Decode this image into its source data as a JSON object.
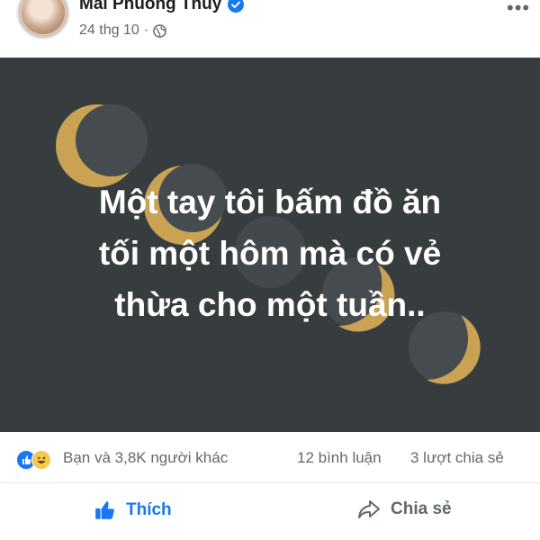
{
  "post": {
    "author": "Mai Phuong Thuy",
    "date": "24 thg 10",
    "separator": "·",
    "text_lines": [
      "Một tay tôi bấm đồ ăn",
      "tối một hôm mà có vẻ",
      "thừa cho một tuần.."
    ],
    "background_color": "#373d3f",
    "moon_color": "#c9a254"
  },
  "stats": {
    "reaction_summary": "Bạn và 3,8K người khác",
    "comments": "12 bình luận",
    "shares": "3 lượt chia sẻ"
  },
  "actions": {
    "like_label": "Thích",
    "share_label": "Chia sẻ"
  },
  "icons": {
    "verified": "verified-badge-icon",
    "globe": "globe-icon",
    "like": "thumbs-up-icon",
    "share": "share-arrow-icon"
  },
  "colors": {
    "accent": "#1877f2",
    "muted_text": "#65676b"
  }
}
